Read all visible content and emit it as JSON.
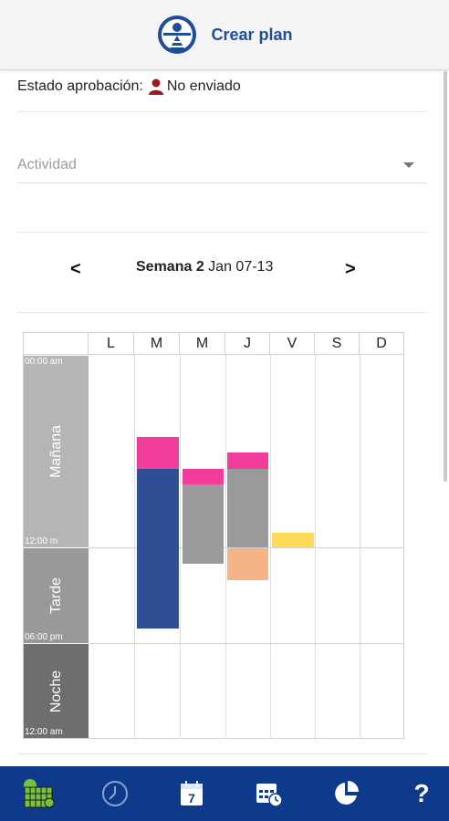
{
  "header": {
    "title": "Crear plan",
    "logo_icon": "company-logo-icon"
  },
  "status": {
    "label": "Estado aprobación:",
    "value": "No enviado",
    "icon": "person-icon",
    "icon_color": "#9b1c1c"
  },
  "activity": {
    "placeholder": "Actividad"
  },
  "week": {
    "prev": "<",
    "next": ">",
    "bold": "Semana 2",
    "range": "Jan 07-13"
  },
  "schedule": {
    "days": [
      "L",
      "M",
      "M",
      "J",
      "V",
      "S",
      "D"
    ],
    "periods": [
      {
        "name": "Mañana",
        "start": "00:00 am",
        "end": "12:00 m",
        "color": "#b5b5b5"
      },
      {
        "name": "Tarde",
        "start": "12:00 m",
        "end": "06:00 pm",
        "color": "#999999"
      },
      {
        "name": "Noche",
        "start": "06:00 pm",
        "end": "12:00 am",
        "color": "#6e6e6e"
      }
    ],
    "colors": {
      "pink": "#f23c9a",
      "blue": "#2e4f95",
      "gray": "#9a9a9a",
      "yellow": "#ffd95a",
      "orange": "#f5b388"
    }
  },
  "bottom_nav": {
    "items": [
      "calendar-grid-icon",
      "clock-icon",
      "day-7-calendar-icon",
      "calendar-clock-icon",
      "pie-chart-icon",
      "help-icon"
    ],
    "help_label": "?",
    "day_number": "7",
    "accent": "#7ac142"
  }
}
